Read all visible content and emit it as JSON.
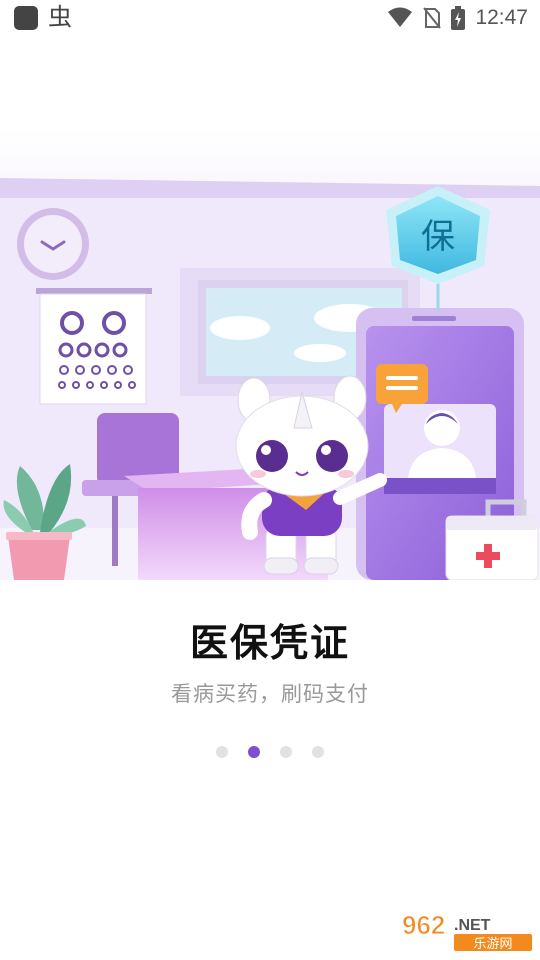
{
  "status_bar": {
    "app_glyph": "虫",
    "time": "12:47",
    "icons": [
      "app-icon",
      "bug-icon",
      "wifi-icon",
      "no-sim-icon",
      "battery-icon"
    ]
  },
  "onboarding": {
    "illustration": {
      "badge_text": "保"
    },
    "title": "医保凭证",
    "subtitle": "看病买药，刷码支付",
    "page_indicator": {
      "total": 4,
      "current": 2
    }
  },
  "watermark": {
    "number": "962",
    "suffix": ".NET",
    "chinese": "乐游网"
  },
  "colors": {
    "accent_purple": "#7d4fd1",
    "shield_blue": "#5fd0ea",
    "bubble_orange": "#f7a33a"
  }
}
